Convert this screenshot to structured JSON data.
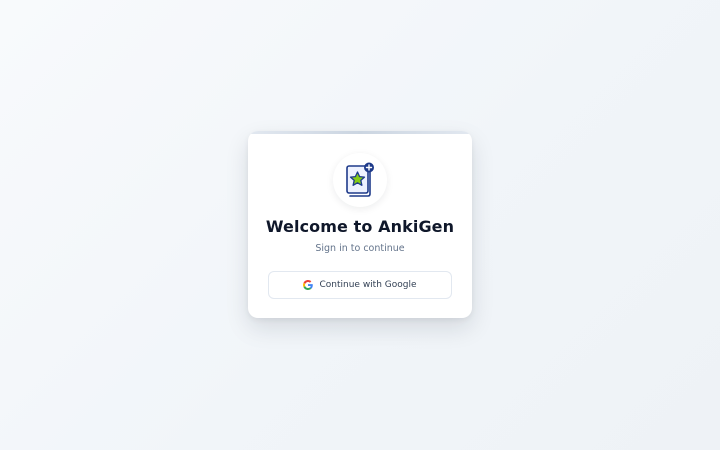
{
  "login": {
    "title": "Welcome to AnkiGen",
    "subtitle": "Sign in to continue",
    "google_button_label": "Continue with Google"
  },
  "icons": {
    "logo": "flashcard-star-plus-icon",
    "google": "google-g-icon"
  },
  "colors": {
    "title": "#0f172a",
    "subtitle": "#64748b",
    "logo_outline": "#1e3a8a",
    "logo_star": "#84cc16",
    "google_blue": "#4285F4",
    "google_red": "#EA4335",
    "google_yellow": "#FBBC05",
    "google_green": "#34A853"
  }
}
